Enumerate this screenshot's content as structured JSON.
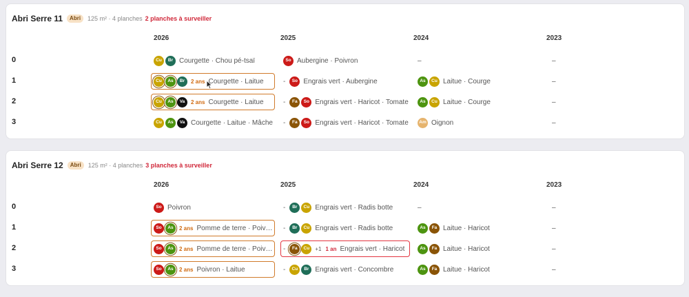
{
  "colors": {
    "Cu": "#c9a400",
    "Br": "#1f6e58",
    "So": "#cc1a18",
    "As": "#4d9410",
    "Va": "#111111",
    "Fa": "#8a5406",
    "Am": "#e6b46e",
    "box_warn": "#d07a2a",
    "box_alert": "#e3343f",
    "alert_text": "#d0283a"
  },
  "sections": [
    {
      "title": "Abri Serre 11",
      "badge": "Abri",
      "meta": "125 m² · 4 planches",
      "alert": "2 planches à surveiller",
      "years": [
        "2026",
        "2025",
        "2024",
        "2023"
      ],
      "rows": [
        {
          "label": "0",
          "cells": [
            {
              "chips": [
                "Cu",
                "Br"
              ],
              "ring": [],
              "text": "Courgette · Chou pé-tsaï"
            },
            {
              "chips": [
                "So"
              ],
              "ring": [],
              "text": "Aubergine · Poivron"
            },
            {
              "text": "–"
            },
            {
              "text": "–"
            }
          ]
        },
        {
          "label": "1",
          "cells": [
            {
              "chips": [
                "Cu",
                "As",
                "Br"
              ],
              "ring": [
                0,
                1
              ],
              "ans": "2 ans",
              "text": "Courgette · Laitue",
              "style": "boxed"
            },
            {
              "pre": "-",
              "chips": [
                "So"
              ],
              "ring": [],
              "text": "Engrais vert · Aubergine"
            },
            {
              "chips": [
                "As",
                "Cu"
              ],
              "ring": [],
              "text": "Laitue · Courge"
            },
            {
              "text": "–"
            }
          ]
        },
        {
          "label": "2",
          "cells": [
            {
              "chips": [
                "Cu",
                "As",
                "Va"
              ],
              "ring": [
                0,
                1
              ],
              "ans": "2 ans",
              "text": "Courgette · Laitue",
              "style": "boxed"
            },
            {
              "pre": "-",
              "chips": [
                "Fa",
                "So"
              ],
              "ring": [],
              "text": "Engrais vert · Haricot · Tomate"
            },
            {
              "chips": [
                "As",
                "Cu"
              ],
              "ring": [],
              "text": "Laitue · Courge"
            },
            {
              "text": "–"
            }
          ]
        },
        {
          "label": "3",
          "cells": [
            {
              "chips": [
                "Cu",
                "As",
                "Va"
              ],
              "ring": [],
              "text": "Courgette · Laitue · Mâche"
            },
            {
              "pre": "-",
              "chips": [
                "Fa",
                "So"
              ],
              "ring": [],
              "text": "Engrais vert · Haricot · Tomate"
            },
            {
              "chips": [
                "Am"
              ],
              "ring": [],
              "text": "Oignon"
            },
            {
              "text": "–"
            }
          ]
        }
      ]
    },
    {
      "title": "Abri Serre 12",
      "badge": "Abri",
      "meta": "125 m² · 4 planches",
      "alert": "3 planches à surveiller",
      "years": [
        "2026",
        "2025",
        "2024",
        "2023"
      ],
      "rows": [
        {
          "label": "0",
          "cells": [
            {
              "chips": [
                "So"
              ],
              "ring": [],
              "text": "Poivron"
            },
            {
              "pre": "-",
              "chips": [
                "Br",
                "Cu"
              ],
              "ring": [],
              "text": "Engrais vert · Radis botte"
            },
            {
              "text": "–"
            },
            {
              "text": "–"
            }
          ]
        },
        {
          "label": "1",
          "cells": [
            {
              "chips": [
                "So",
                "As"
              ],
              "ring": [
                1
              ],
              "ans": "2 ans",
              "text": "Pomme de terre · Poivron",
              "style": "boxed"
            },
            {
              "pre": "-",
              "chips": [
                "Br",
                "Cu"
              ],
              "ring": [],
              "text": "Engrais vert · Radis botte"
            },
            {
              "chips": [
                "As",
                "Fa"
              ],
              "ring": [],
              "text": "Laitue · Haricot"
            },
            {
              "text": "–"
            }
          ]
        },
        {
          "label": "2",
          "cells": [
            {
              "chips": [
                "So",
                "As"
              ],
              "ring": [
                1
              ],
              "ans": "2 ans",
              "text": "Pomme de terre · Poivron",
              "style": "boxed"
            },
            {
              "pre": "-",
              "chips": [
                "Fa",
                "Cu"
              ],
              "ring": [
                0
              ],
              "plus": "+1",
              "ans": "1 an",
              "ans_red": true,
              "text": "Engrais vert · Haricot",
              "style": "red"
            },
            {
              "chips": [
                "As",
                "Fa"
              ],
              "ring": [],
              "text": "Laitue · Haricot"
            },
            {
              "text": "–"
            }
          ]
        },
        {
          "label": "3",
          "cells": [
            {
              "chips": [
                "So",
                "As"
              ],
              "ring": [
                1
              ],
              "ans": "2 ans",
              "text": "Poivron · Laitue",
              "style": "boxed"
            },
            {
              "pre": "-",
              "chips": [
                "Cu",
                "Br"
              ],
              "ring": [],
              "text": "Engrais vert · Concombre"
            },
            {
              "chips": [
                "As",
                "Fa"
              ],
              "ring": [],
              "text": "Laitue · Haricot"
            },
            {
              "text": "–"
            }
          ]
        }
      ]
    }
  ]
}
